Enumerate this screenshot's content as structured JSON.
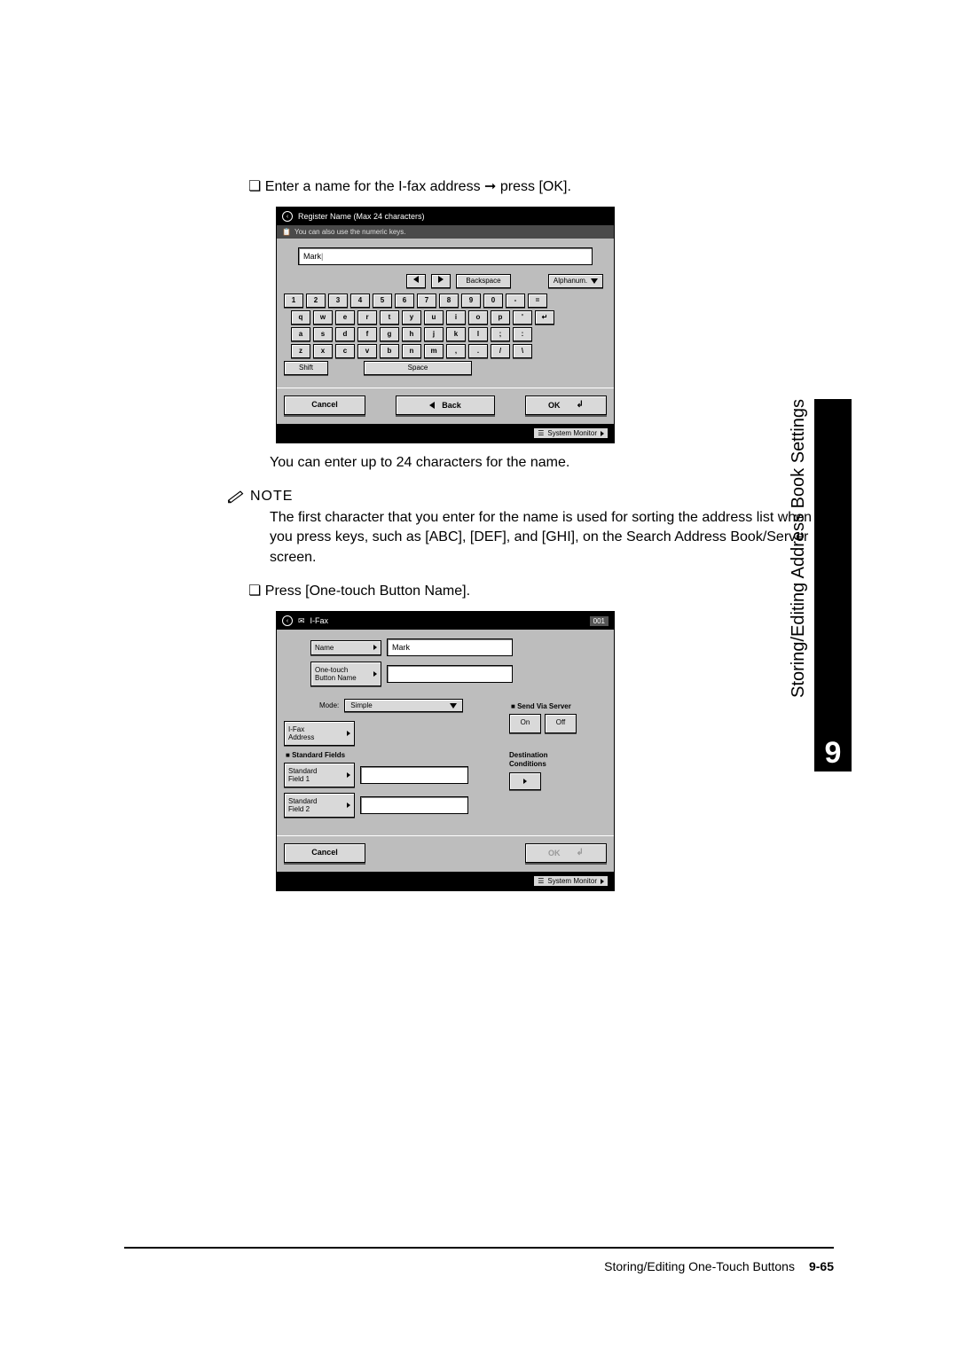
{
  "instructions": {
    "line1": "❏ Enter a name for the I-fax address ➞ press [OK].",
    "caption1": "You can enter up to 24 characters for the name.",
    "note_label": "NOTE",
    "note_body": "The first character that you enter for the name is used for sorting the address list when you press keys, such as [ABC], [DEF], and [GHI], on the Search Address Book/Server screen.",
    "line2": "❏ Press [One-touch Button Name]."
  },
  "shot1": {
    "title": "Register Name (Max 24 characters)",
    "hint": "You can also use the numeric keys.",
    "input_value": "Mark",
    "backspace": "Backspace",
    "mode": "Alphanum.",
    "rows": [
      [
        "1",
        "2",
        "3",
        "4",
        "5",
        "6",
        "7",
        "8",
        "9",
        "0",
        "-",
        "="
      ],
      [
        "q",
        "w",
        "e",
        "r",
        "t",
        "y",
        "u",
        "i",
        "o",
        "p",
        "'",
        "↵"
      ],
      [
        "a",
        "s",
        "d",
        "f",
        "g",
        "h",
        "j",
        "k",
        "l",
        ";",
        ":"
      ],
      [
        "z",
        "x",
        "c",
        "v",
        "b",
        "n",
        "m",
        ",",
        ".",
        "/",
        "\\"
      ]
    ],
    "shift": "Shift",
    "space": "Space",
    "cancel": "Cancel",
    "back": "Back",
    "ok": "OK",
    "sysmon": "System Monitor"
  },
  "shot2": {
    "title": "I-Fax",
    "slot": "001",
    "name_label": "Name",
    "name_value": "Mark",
    "onetouch_label": "One-touch\nButton Name",
    "mode_label": "Mode:",
    "mode_value": "Simple",
    "send_via": "Send Via Server",
    "on": "On",
    "off": "Off",
    "ifax_addr": "I-Fax\nAddress",
    "std_fields": "Standard Fields",
    "std1": "Standard\nField 1",
    "std2": "Standard\nField 2",
    "dest_cond": "Destination\nConditions",
    "cancel": "Cancel",
    "ok": "OK",
    "sysmon": "System Monitor"
  },
  "side": {
    "chapter": "9",
    "label": "Storing/Editing Address Book Settings"
  },
  "footer": {
    "section": "Storing/Editing One-Touch Buttons",
    "page": "9-65"
  }
}
